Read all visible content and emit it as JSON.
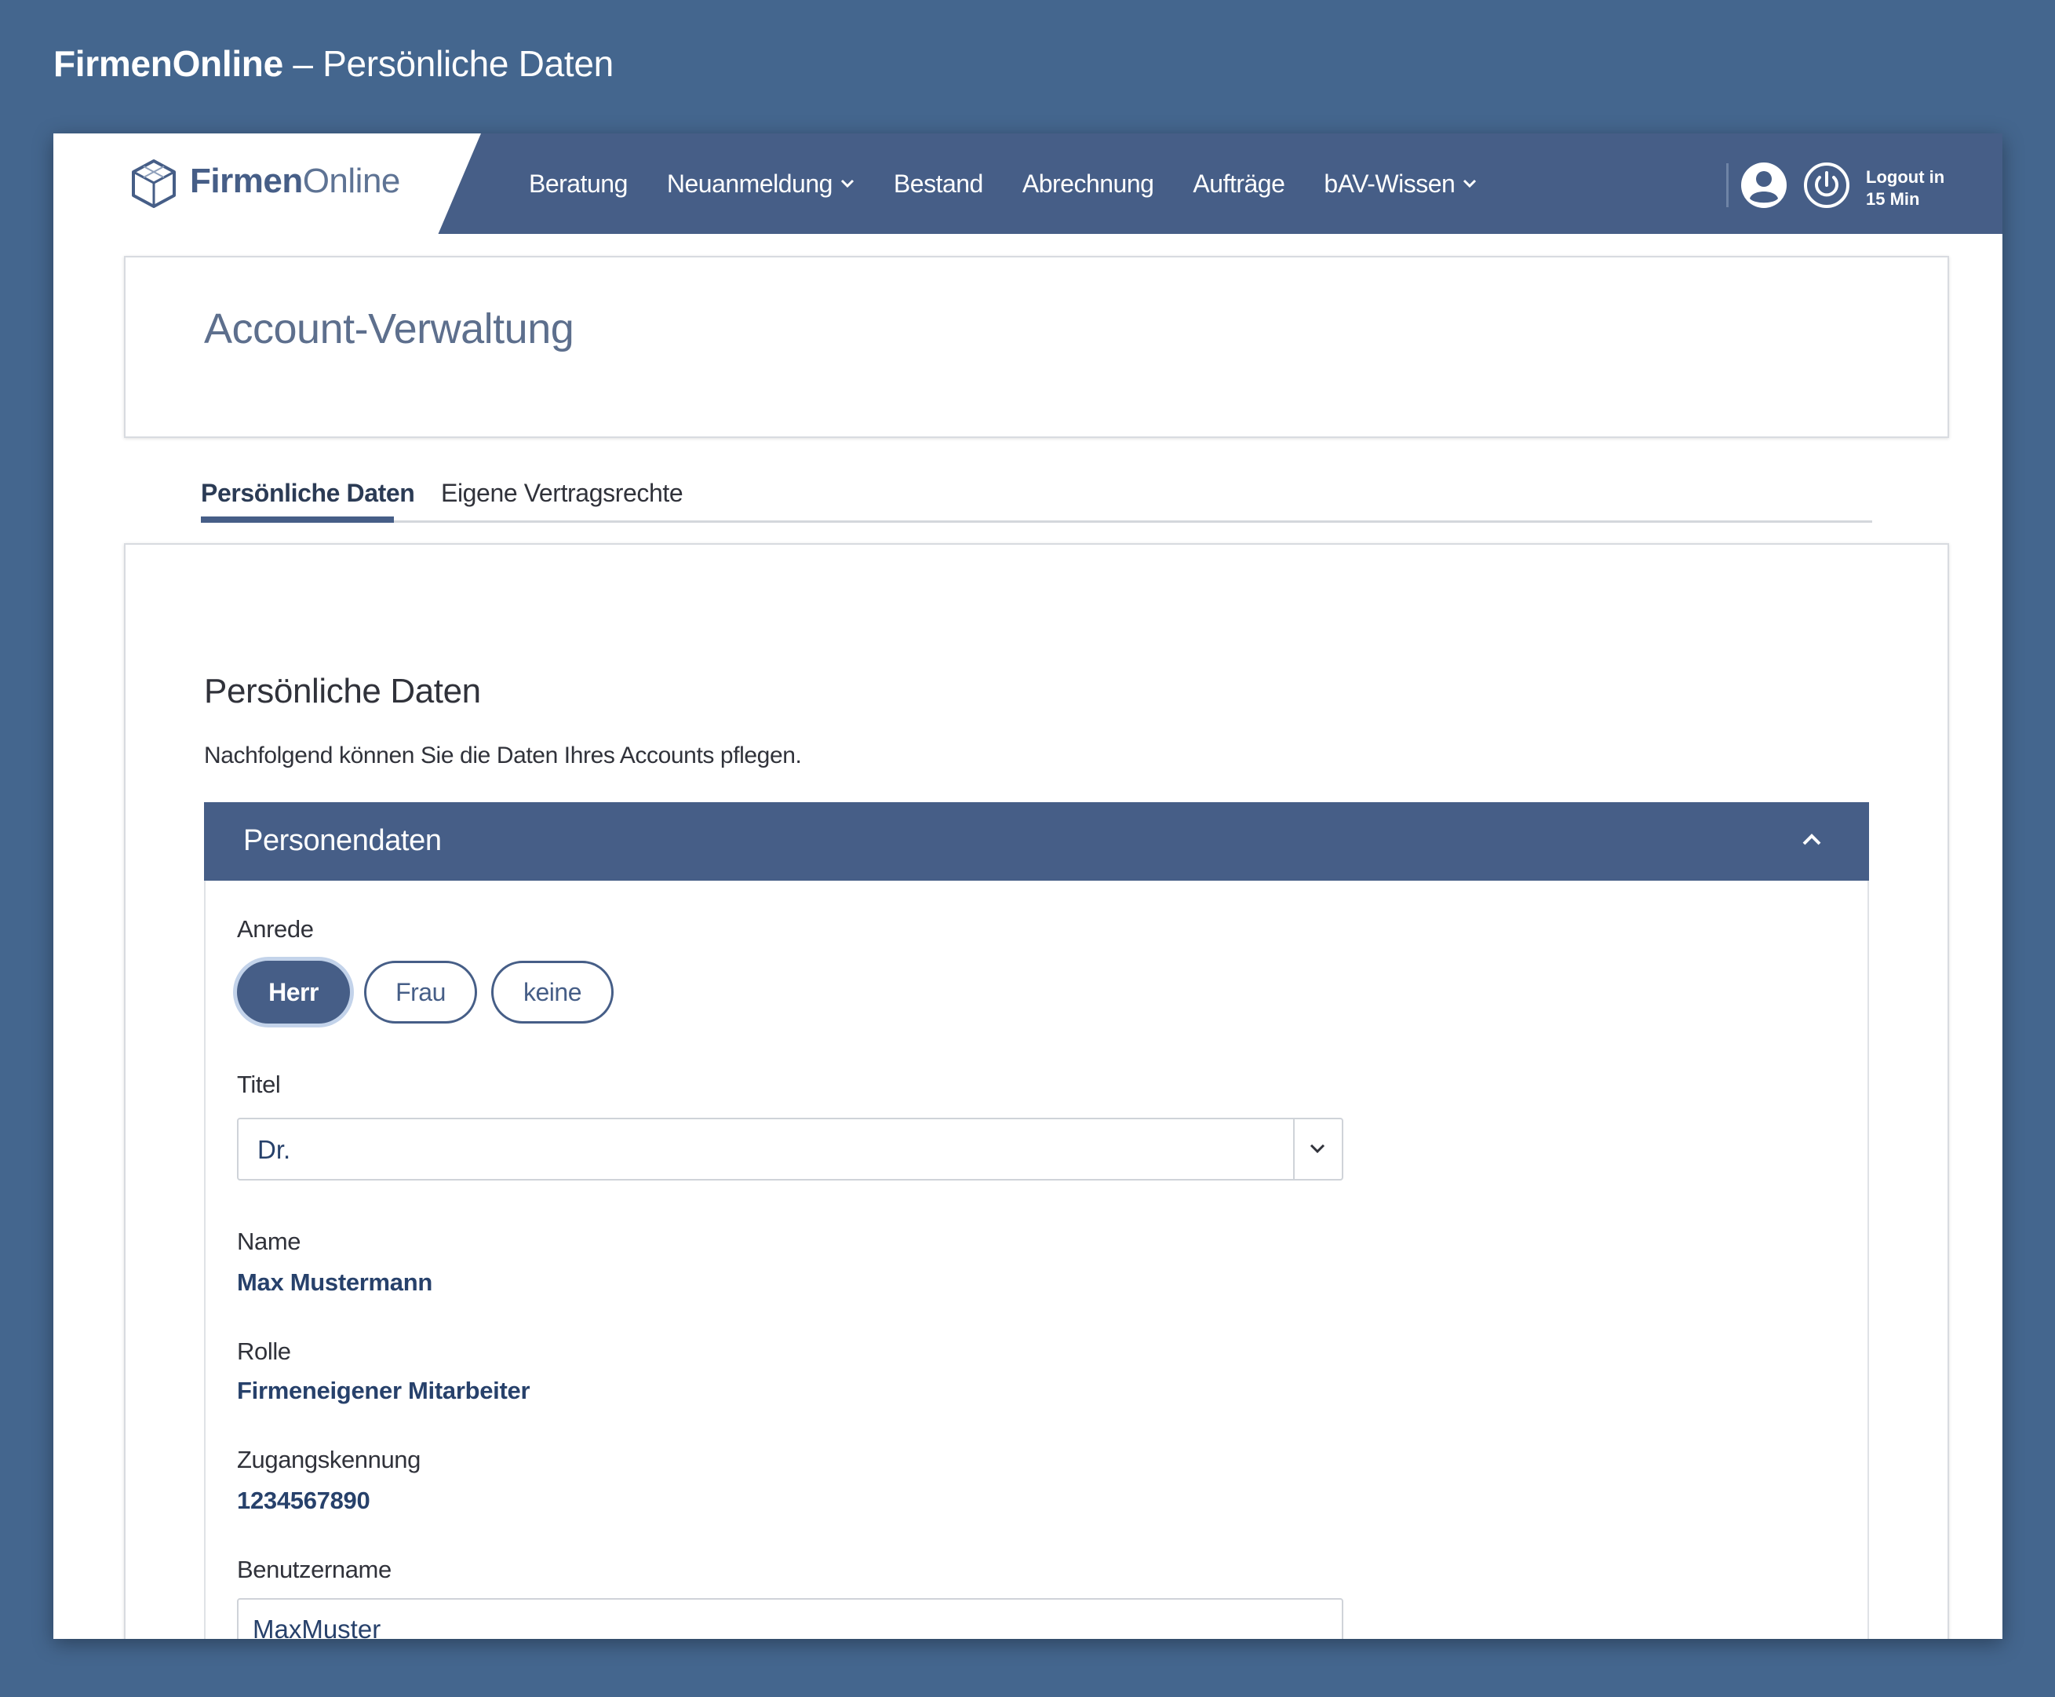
{
  "heading": {
    "brand": "FirmenOnline",
    "rest": " – Persönliche Daten"
  },
  "navbar": {
    "logo_bold": "Firmen",
    "logo_light": "Online",
    "items": [
      {
        "label": "Beratung",
        "dropdown": false
      },
      {
        "label": "Neuanmeldung",
        "dropdown": true
      },
      {
        "label": "Bestand",
        "dropdown": false
      },
      {
        "label": "Abrechnung",
        "dropdown": false
      },
      {
        "label": "Aufträge",
        "dropdown": false
      },
      {
        "label": "bAV-Wissen",
        "dropdown": true
      }
    ],
    "logout_line1": "Logout in",
    "logout_line2": "15 Min",
    "icons": [
      "cube-logo-icon",
      "user-icon",
      "power-icon",
      "chevron-down-icon"
    ]
  },
  "account": {
    "title": "Account-Verwaltung"
  },
  "tabs": [
    {
      "label": "Persönliche Daten",
      "active": true
    },
    {
      "label": "Eigene Vertragsrechte",
      "active": false
    }
  ],
  "section": {
    "title": "Persönliche Daten",
    "description": "Nachfolgend können Sie die Daten Ihres Accounts pflegen."
  },
  "panel": {
    "title": "Personendaten",
    "anrede": {
      "label": "Anrede",
      "options": [
        "Herr",
        "Frau",
        "keine"
      ],
      "selected": "Herr"
    },
    "titel": {
      "label": "Titel",
      "value": "Dr."
    },
    "name": {
      "label": "Name",
      "value": "Max Mustermann"
    },
    "rolle": {
      "label": "Rolle",
      "value": "Firmeneigener Mitarbeiter"
    },
    "zugangskennung": {
      "label": "Zugangskennung",
      "value": "1234567890"
    },
    "benutzername": {
      "label": "Benutzername",
      "value": "MaxMuster"
    }
  },
  "colors": {
    "background": "#44668e",
    "primary": "#465e87",
    "value_text": "#27416b",
    "focus_ring": "#c3d3ea"
  }
}
